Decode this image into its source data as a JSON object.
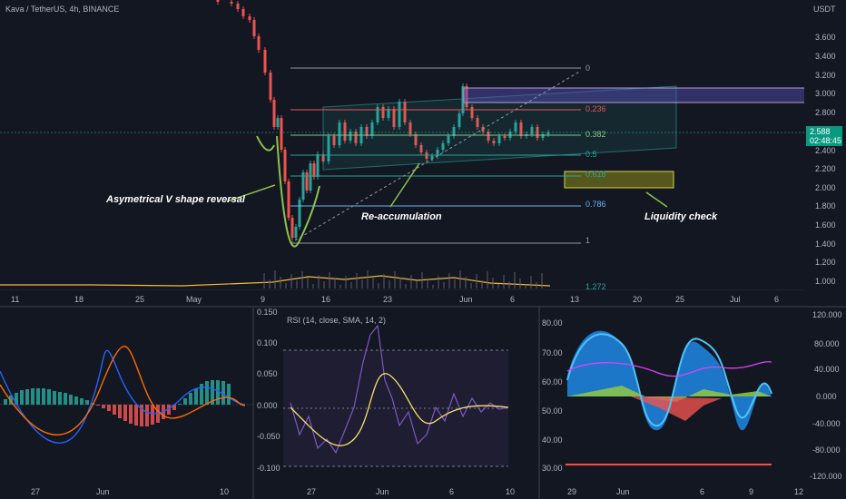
{
  "header": {
    "title": "Kava / TetherUS, 4h, BINANCE",
    "currency": "USDT"
  },
  "main_axis": {
    "y_labels": [
      "3.600",
      "3.400",
      "3.200",
      "3.000",
      "2.800",
      "2.600",
      "2.400",
      "2.200",
      "2.000",
      "1.800",
      "1.600",
      "1.400",
      "1.200",
      "1.000"
    ],
    "x_labels": [
      "11",
      "18",
      "25",
      "May",
      "9",
      "16",
      "23",
      "Jun",
      "6",
      "13",
      "20",
      "25",
      "Jul",
      "6"
    ]
  },
  "price": {
    "value": "2.588",
    "countdown": "02:48:45"
  },
  "fib_levels": [
    "0",
    "0.236",
    "0.382",
    "0.5",
    "0.618",
    "0.786",
    "1",
    "1.272"
  ],
  "annotations": {
    "v_shape": "Asymetrical V shape reversal",
    "reaccum": "Re-accumulation",
    "liquidity": "Liquidity check"
  },
  "macd_pane": {
    "x_labels": [
      "27",
      "Jun",
      "10"
    ]
  },
  "rsi_pane": {
    "title": "RSI (14, close, SMA, 14, 2)",
    "y_labels": [
      "0.150",
      "0.100",
      "0.050",
      "0.000",
      "-0.050",
      "-0.100"
    ],
    "x_labels": [
      "27",
      "Jun",
      "6",
      "10"
    ]
  },
  "osc_pane": {
    "y_labels_left": [
      "80.00",
      "70.00",
      "60.00",
      "50.00",
      "40.00",
      "30.00"
    ],
    "y_labels_right": [
      "120.000",
      "80.000",
      "40.000",
      "0.000",
      "-40.000",
      "-80.000",
      "-120.000"
    ],
    "x_labels": [
      "29",
      "Jun",
      "6",
      "9",
      "12"
    ]
  },
  "colors": {
    "background": "#131722",
    "up": "#26a69a",
    "down": "#ef5350",
    "fib": "#26a69a",
    "zone_purple": "#5b4fbf",
    "zone_yellow": "#8c8c1a"
  }
}
